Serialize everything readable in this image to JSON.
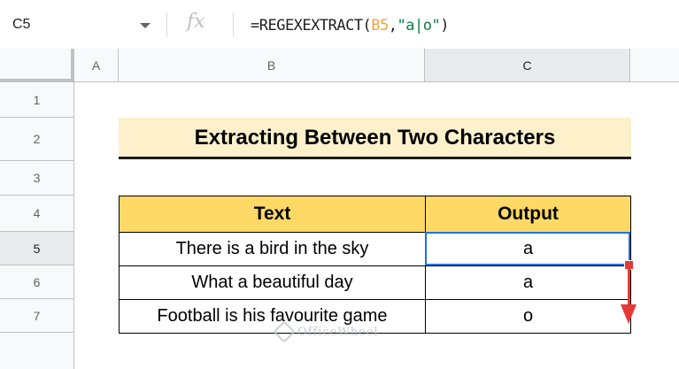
{
  "formula_bar": {
    "name_box": "C5",
    "fx_icon": "fx-icon",
    "formula_parts": {
      "prefix": "=REGEXEXTRACT(",
      "ref": "B5",
      "comma": ",",
      "string": "\"a|o\"",
      "suffix": ")"
    }
  },
  "columns": [
    "A",
    "B",
    "C"
  ],
  "rows": [
    "1",
    "2",
    "3",
    "4",
    "5",
    "6",
    "7"
  ],
  "active_cell": {
    "column": "C",
    "row": "5"
  },
  "title": "Extracting Between Two Characters",
  "table": {
    "headers": [
      "Text",
      "Output"
    ],
    "rows": [
      {
        "text": "There is a bird in the sky",
        "output": "a"
      },
      {
        "text": "What a beautiful day",
        "output": "a"
      },
      {
        "text": "Football is his favourite game",
        "output": "o"
      }
    ]
  },
  "colors": {
    "title_bg": "#fdf1cc",
    "header_bg": "#ffd966",
    "selection": "#1a73e8",
    "arrow": "#e53935"
  },
  "watermark": "OfficeWheel"
}
